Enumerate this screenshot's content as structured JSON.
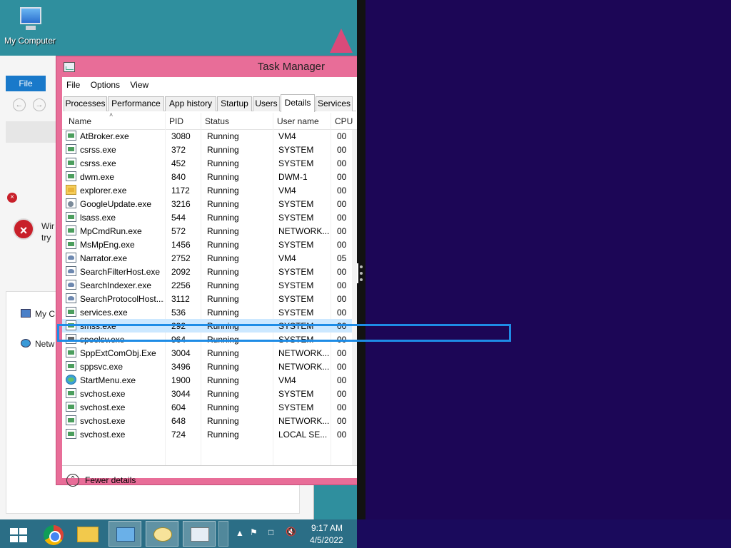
{
  "desktop": {
    "icons": [
      {
        "label": "My Computer",
        "icon": "computer-icon"
      }
    ]
  },
  "background_window": {
    "file_tab": "File",
    "fragments": {
      "error_text_1": "Wir",
      "error_text_2": "try",
      "tree_item_1": "My C",
      "tree_item_2": "Netw"
    }
  },
  "task_manager": {
    "title": "Task Manager",
    "menu": [
      "File",
      "Options",
      "View"
    ],
    "tabs": [
      {
        "label": "Processes",
        "active": false
      },
      {
        "label": "Performance",
        "active": false
      },
      {
        "label": "App history",
        "active": false
      },
      {
        "label": "Startup",
        "active": false
      },
      {
        "label": "Users",
        "active": false
      },
      {
        "label": "Details",
        "active": true
      },
      {
        "label": "Services",
        "active": false
      }
    ],
    "columns": [
      "Name",
      "PID",
      "Status",
      "User name",
      "CPU"
    ],
    "rows": [
      {
        "name": "AtBroker.exe",
        "pid": "3080",
        "status": "Running",
        "user": "VM4",
        "cpu": "00",
        "icon": "app"
      },
      {
        "name": "csrss.exe",
        "pid": "372",
        "status": "Running",
        "user": "SYSTEM",
        "cpu": "00",
        "icon": "app"
      },
      {
        "name": "csrss.exe",
        "pid": "452",
        "status": "Running",
        "user": "SYSTEM",
        "cpu": "00",
        "icon": "app"
      },
      {
        "name": "dwm.exe",
        "pid": "840",
        "status": "Running",
        "user": "DWM-1",
        "cpu": "00",
        "icon": "app"
      },
      {
        "name": "explorer.exe",
        "pid": "1172",
        "status": "Running",
        "user": "VM4",
        "cpu": "00",
        "icon": "folder"
      },
      {
        "name": "GoogleUpdate.exe",
        "pid": "3216",
        "status": "Running",
        "user": "SYSTEM",
        "cpu": "00",
        "icon": "gear"
      },
      {
        "name": "lsass.exe",
        "pid": "544",
        "status": "Running",
        "user": "SYSTEM",
        "cpu": "00",
        "icon": "app"
      },
      {
        "name": "MpCmdRun.exe",
        "pid": "572",
        "status": "Running",
        "user": "NETWORK...",
        "cpu": "00",
        "icon": "app"
      },
      {
        "name": "MsMpEng.exe",
        "pid": "1456",
        "status": "Running",
        "user": "SYSTEM",
        "cpu": "00",
        "icon": "app"
      },
      {
        "name": "Narrator.exe",
        "pid": "2752",
        "status": "Running",
        "user": "VM4",
        "cpu": "05",
        "icon": "user"
      },
      {
        "name": "SearchFilterHost.exe",
        "pid": "2092",
        "status": "Running",
        "user": "SYSTEM",
        "cpu": "00",
        "icon": "user"
      },
      {
        "name": "SearchIndexer.exe",
        "pid": "2256",
        "status": "Running",
        "user": "SYSTEM",
        "cpu": "00",
        "icon": "user"
      },
      {
        "name": "SearchProtocolHost....",
        "pid": "3112",
        "status": "Running",
        "user": "SYSTEM",
        "cpu": "00",
        "icon": "user"
      },
      {
        "name": "services.exe",
        "pid": "536",
        "status": "Running",
        "user": "SYSTEM",
        "cpu": "00",
        "icon": "app"
      },
      {
        "name": "smss.exe",
        "pid": "292",
        "status": "Running",
        "user": "SYSTEM",
        "cpu": "00",
        "icon": "app",
        "selected": true
      },
      {
        "name": "spoolsv.exe",
        "pid": "964",
        "status": "Running",
        "user": "SYSTEM",
        "cpu": "00",
        "icon": "printer"
      },
      {
        "name": "SppExtComObj.Exe",
        "pid": "3004",
        "status": "Running",
        "user": "NETWORK...",
        "cpu": "00",
        "icon": "app"
      },
      {
        "name": "sppsvc.exe",
        "pid": "3496",
        "status": "Running",
        "user": "NETWORK...",
        "cpu": "00",
        "icon": "app"
      },
      {
        "name": "StartMenu.exe",
        "pid": "1900",
        "status": "Running",
        "user": "VM4",
        "cpu": "00",
        "icon": "globe"
      },
      {
        "name": "svchost.exe",
        "pid": "3044",
        "status": "Running",
        "user": "SYSTEM",
        "cpu": "00",
        "icon": "app"
      },
      {
        "name": "svchost.exe",
        "pid": "604",
        "status": "Running",
        "user": "SYSTEM",
        "cpu": "00",
        "icon": "app"
      },
      {
        "name": "svchost.exe",
        "pid": "648",
        "status": "Running",
        "user": "NETWORK...",
        "cpu": "00",
        "icon": "app"
      },
      {
        "name": "svchost.exe",
        "pid": "724",
        "status": "Running",
        "user": "LOCAL SE...",
        "cpu": "00",
        "icon": "app"
      }
    ],
    "footer": {
      "fewer_details": "Fewer details"
    }
  },
  "taskbar": {
    "clock_time": "9:17 AM",
    "clock_date": "4/5/2022",
    "apps": [
      "start-button",
      "chrome-icon",
      "file-explorer-icon",
      "app-icon",
      "narrator-icon",
      "task-manager-icon"
    ]
  },
  "colors": {
    "taskmgr_frame": "#e86d98",
    "highlight": "#1e8ce6",
    "selected_row": "#cce8ff",
    "right_panel": "#1c0656",
    "taskbar": "#2b6e86"
  }
}
